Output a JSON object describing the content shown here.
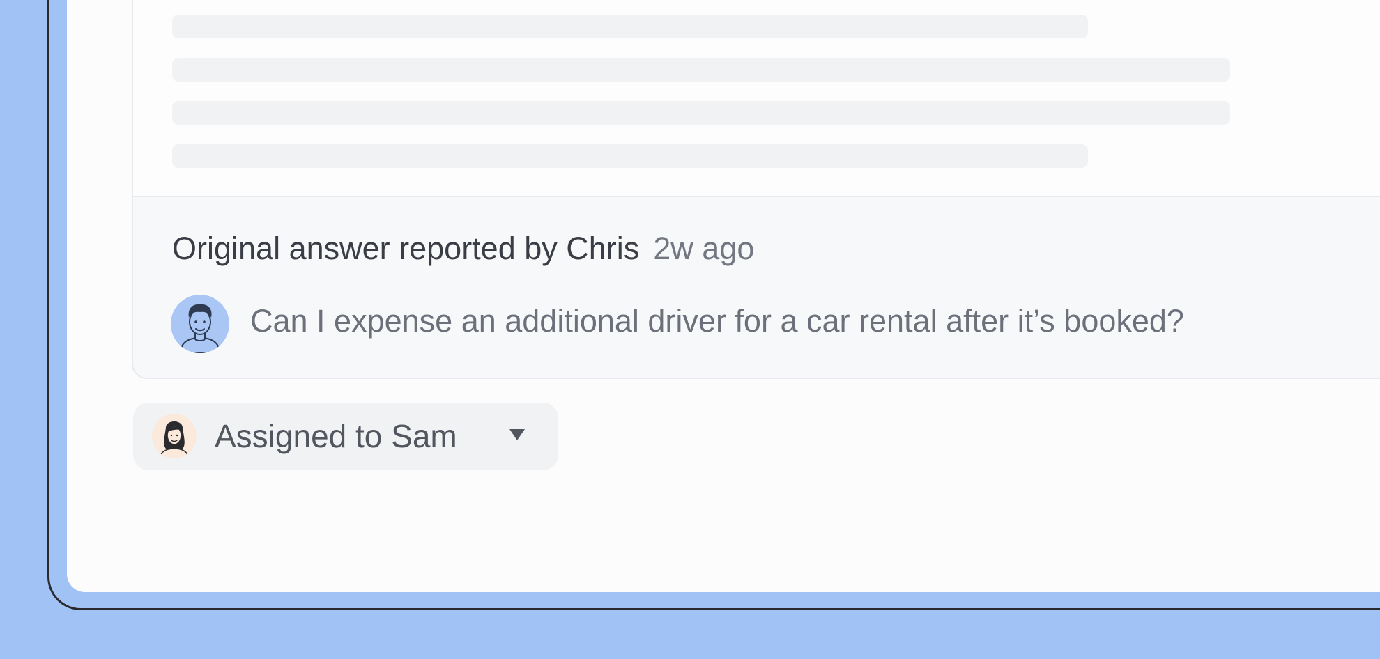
{
  "report": {
    "title": "Original answer reported by Chris",
    "time": "2w ago",
    "question": "Can I expense an additional driver for a car rental after it’s booked?",
    "reporter_avatar": "avatar-man-icon"
  },
  "assignment": {
    "label": "Assigned to Sam",
    "assignee_avatar": "avatar-woman-icon",
    "dropdown_icon": "chevron-down-icon"
  },
  "colors": {
    "background": "#a1c2f5",
    "screen": "#fcfcfc",
    "report_panel": "#f7f8fa",
    "skeleton": "#f1f2f4",
    "heading_text": "#3a3d45",
    "secondary_text": "#737782"
  }
}
